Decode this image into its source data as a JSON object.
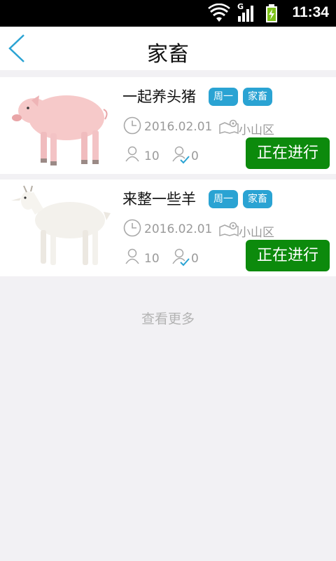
{
  "status_bar": {
    "time": "11:34",
    "network_label": "G",
    "icons": [
      "wifi-icon",
      "signal-icon",
      "battery-charging-icon"
    ]
  },
  "header": {
    "title": "家畜",
    "back_icon": "back-chevron-icon",
    "accent_color": "#2aa3d3"
  },
  "cards": [
    {
      "name": "一起养头猪",
      "tags": [
        "周一",
        "家畜"
      ],
      "date": "2016.02.01",
      "location": "小山区",
      "participants": "10",
      "confirmed": "0",
      "status": "正在进行",
      "image": "pig"
    },
    {
      "name": "来整一些羊",
      "tags": [
        "周一",
        "家畜"
      ],
      "date": "2016.02.01",
      "location": "小山区",
      "participants": "10",
      "confirmed": "0",
      "status": "正在进行",
      "image": "goat"
    }
  ],
  "load_more_label": "查看更多",
  "colors": {
    "tag_bg": "#2aa3d3",
    "status_bg": "#0c8a0c",
    "page_bg": "#f2f1f4"
  }
}
